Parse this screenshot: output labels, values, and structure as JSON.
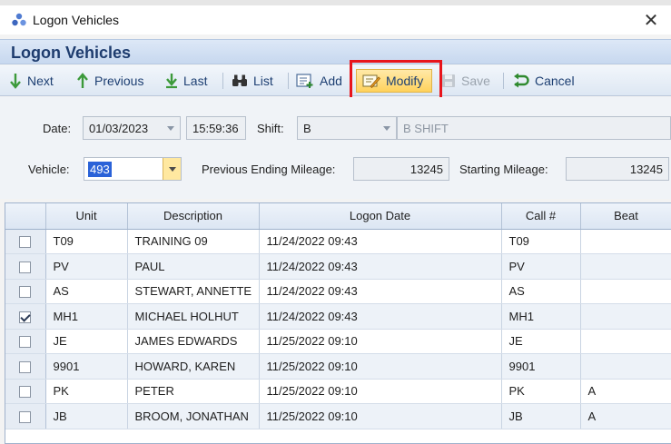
{
  "window": {
    "title": "Logon Vehicles"
  },
  "header": {
    "title": "Logon Vehicles"
  },
  "toolbar": {
    "next": "Next",
    "previous": "Previous",
    "last": "Last",
    "list": "List",
    "add": "Add",
    "modify": "Modify",
    "save": "Save",
    "cancel": "Cancel"
  },
  "form": {
    "date_label": "Date:",
    "date_value": "01/03/2023",
    "time_value": "15:59:36",
    "shift_label": "Shift:",
    "shift_value": "B",
    "shift_description": "B SHIFT",
    "vehicle_label": "Vehicle:",
    "vehicle_value": "493",
    "prev_mileage_label": "Previous Ending Mileage:",
    "prev_mileage_value": "13245",
    "start_mileage_label": "Starting Mileage:",
    "start_mileage_value": "13245"
  },
  "grid": {
    "columns": [
      "Unit",
      "Description",
      "Logon Date",
      "Call #",
      "Beat"
    ],
    "rows": [
      {
        "checked": false,
        "unit": "T09",
        "description": "TRAINING 09",
        "logon_date": "11/24/2022 09:43",
        "call": "T09",
        "beat": ""
      },
      {
        "checked": false,
        "unit": "PV",
        "description": "PAUL",
        "logon_date": "11/24/2022 09:43",
        "call": "PV",
        "beat": ""
      },
      {
        "checked": false,
        "unit": "AS",
        "description": "STEWART, ANNETTE",
        "logon_date": "11/24/2022 09:43",
        "call": "AS",
        "beat": ""
      },
      {
        "checked": true,
        "unit": "MH1",
        "description": "MICHAEL HOLHUT",
        "logon_date": "11/24/2022 09:43",
        "call": "MH1",
        "beat": ""
      },
      {
        "checked": false,
        "unit": "JE",
        "description": "JAMES EDWARDS",
        "logon_date": "11/25/2022 09:10",
        "call": "JE",
        "beat": ""
      },
      {
        "checked": false,
        "unit": "9901",
        "description": "HOWARD, KAREN",
        "logon_date": "11/25/2022 09:10",
        "call": "9901",
        "beat": ""
      },
      {
        "checked": false,
        "unit": "PK",
        "description": "PETER",
        "logon_date": "11/25/2022 09:10",
        "call": "PK",
        "beat": "A"
      },
      {
        "checked": false,
        "unit": "JB",
        "description": "BROOM, JONATHAN",
        "logon_date": "11/25/2022 09:10",
        "call": "JB",
        "beat": "A"
      }
    ]
  },
  "colors": {
    "accent": "#1d3f72",
    "highlight": "#e8141b",
    "modify_bg": "#ffd25c",
    "selection": "#2a62d8"
  }
}
